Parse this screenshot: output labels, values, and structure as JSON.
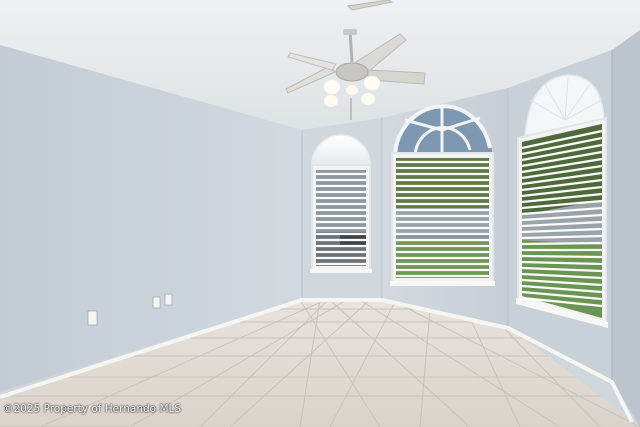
{
  "photo": {
    "watermark": "©2025 Property of Hernando MLS"
  }
}
